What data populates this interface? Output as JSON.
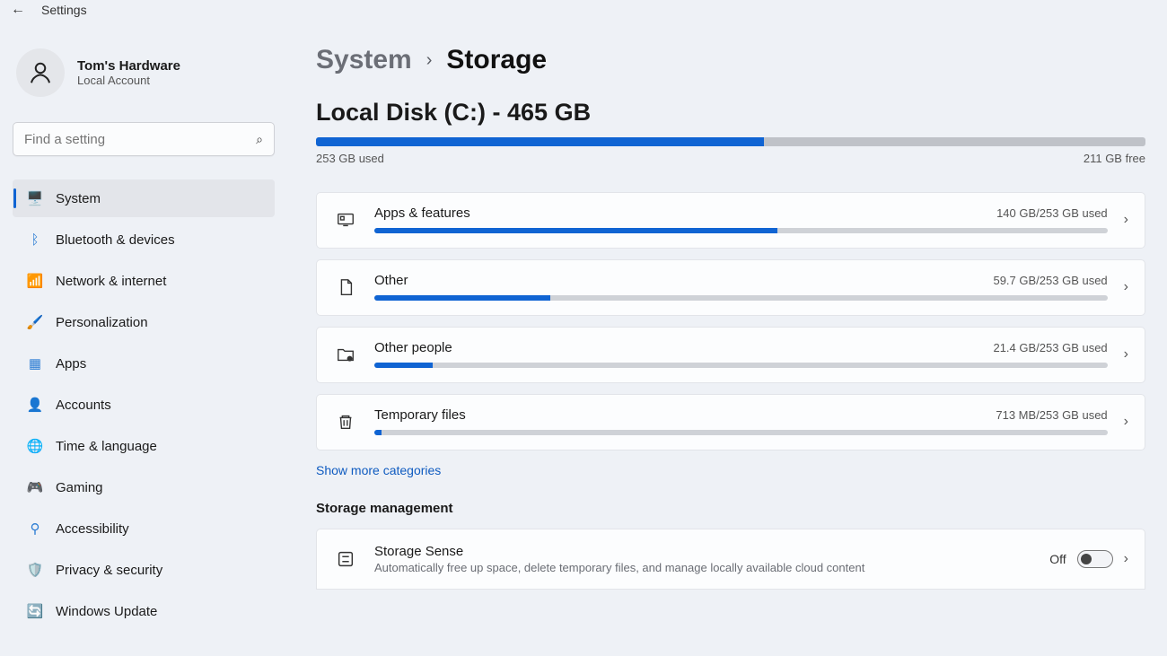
{
  "titlebar": {
    "app_name": "Settings"
  },
  "profile": {
    "name": "Tom's Hardware",
    "subtitle": "Local Account"
  },
  "search": {
    "placeholder": "Find a setting"
  },
  "nav": {
    "items": [
      {
        "label": "System",
        "icon": "🖥️",
        "name": "system"
      },
      {
        "label": "Bluetooth & devices",
        "icon": "ᛒ",
        "name": "bluetooth"
      },
      {
        "label": "Network & internet",
        "icon": "📶",
        "name": "network"
      },
      {
        "label": "Personalization",
        "icon": "🖌️",
        "name": "personalization"
      },
      {
        "label": "Apps",
        "icon": "▦",
        "name": "apps"
      },
      {
        "label": "Accounts",
        "icon": "👤",
        "name": "accounts"
      },
      {
        "label": "Time & language",
        "icon": "🌐",
        "name": "time"
      },
      {
        "label": "Gaming",
        "icon": "🎮",
        "name": "gaming"
      },
      {
        "label": "Accessibility",
        "icon": "⚲",
        "name": "accessibility"
      },
      {
        "label": "Privacy & security",
        "icon": "🛡️",
        "name": "privacy"
      },
      {
        "label": "Windows Update",
        "icon": "🔄",
        "name": "update"
      }
    ],
    "selected_index": 0
  },
  "breadcrumb": {
    "parent": "System",
    "current": "Storage"
  },
  "disk": {
    "title": "Local Disk (C:) - 465 GB",
    "used_label": "253 GB used",
    "free_label": "211 GB free",
    "used_pct": 54
  },
  "categories": [
    {
      "name": "Apps & features",
      "usage": "140 GB/253 GB used",
      "pct": 55,
      "icon": "apps-icon"
    },
    {
      "name": "Other",
      "usage": "59.7 GB/253 GB used",
      "pct": 24,
      "icon": "file-icon"
    },
    {
      "name": "Other people",
      "usage": "21.4 GB/253 GB used",
      "pct": 8,
      "icon": "person-folder-icon"
    },
    {
      "name": "Temporary files",
      "usage": "713 MB/253 GB used",
      "pct": 1,
      "icon": "trash-icon"
    }
  ],
  "show_more": "Show more categories",
  "management": {
    "heading": "Storage management",
    "sense": {
      "title": "Storage Sense",
      "desc": "Automatically free up space, delete temporary files, and manage locally available cloud content",
      "state_label": "Off"
    }
  },
  "colors": {
    "accent": "#1064d3"
  },
  "icon_colors": {
    "system": "#2b7cd3",
    "bluetooth": "#2b7cd3",
    "network": "#2b9a62",
    "personalization": "#c47a2e",
    "apps": "#2b7cd3",
    "accounts": "#3a9a47",
    "time": "#2b7cd3",
    "gaming": "#6b6e76",
    "accessibility": "#2b7cd3",
    "privacy": "#6b6e76",
    "update": "#1e6fd6"
  }
}
